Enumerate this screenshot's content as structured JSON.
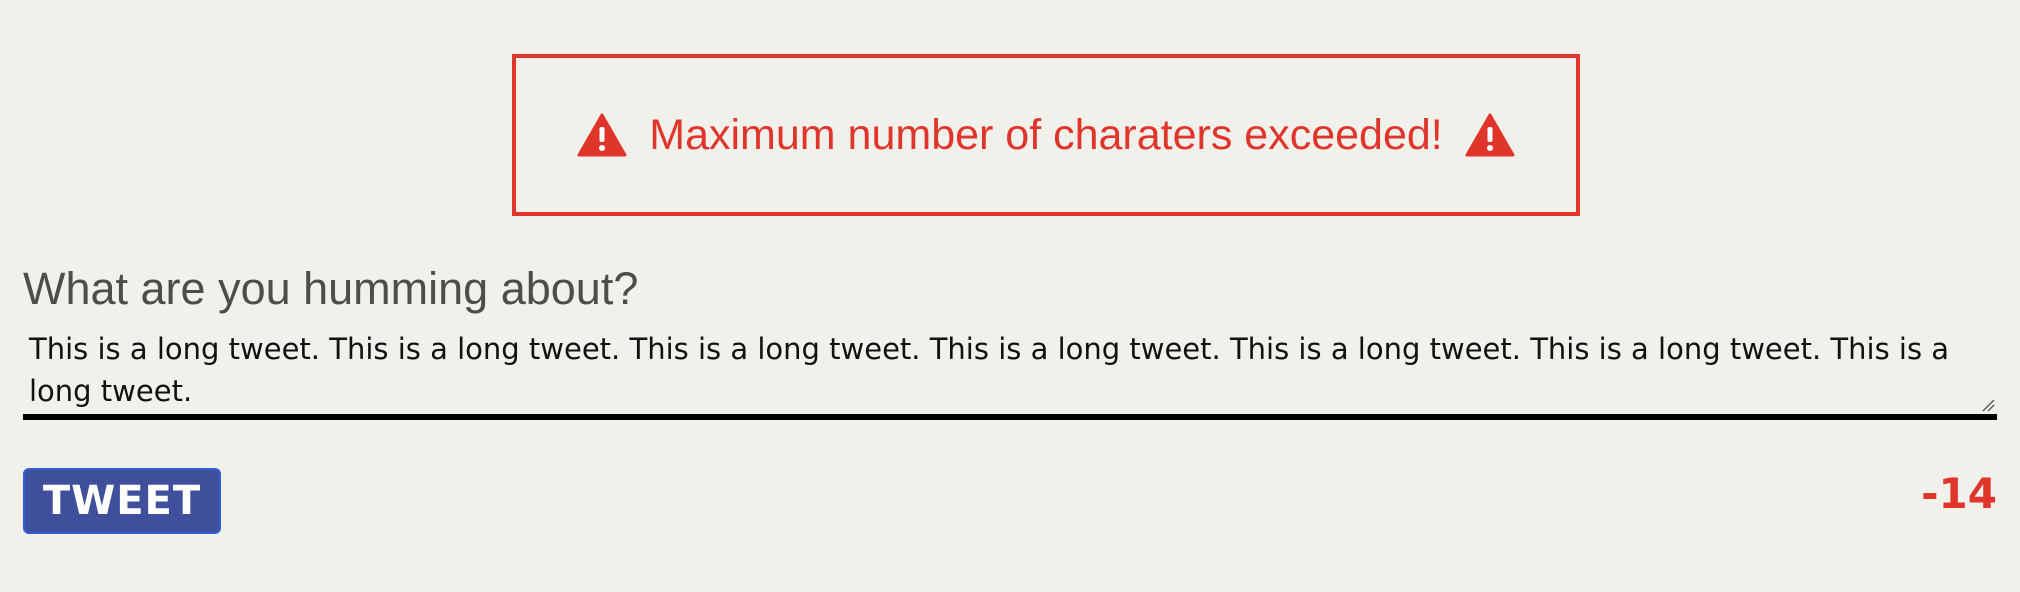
{
  "alert": {
    "message": "Maximum number of charaters exceeded!",
    "icon": "warning-triangle-icon",
    "color": "#e0352b"
  },
  "composer": {
    "prompt": "What are you humming about?",
    "text": "This is a long tweet. This is a long tweet. This is a long tweet. This is a long tweet. This is a long tweet. This is a long tweet. This is a long tweet."
  },
  "actions": {
    "tweet_label": "TWEET",
    "tweet_button_color": "#3f4f9c"
  },
  "counter": {
    "remaining": "-14",
    "color": "#e0352b"
  },
  "background": "#f2f0eb"
}
